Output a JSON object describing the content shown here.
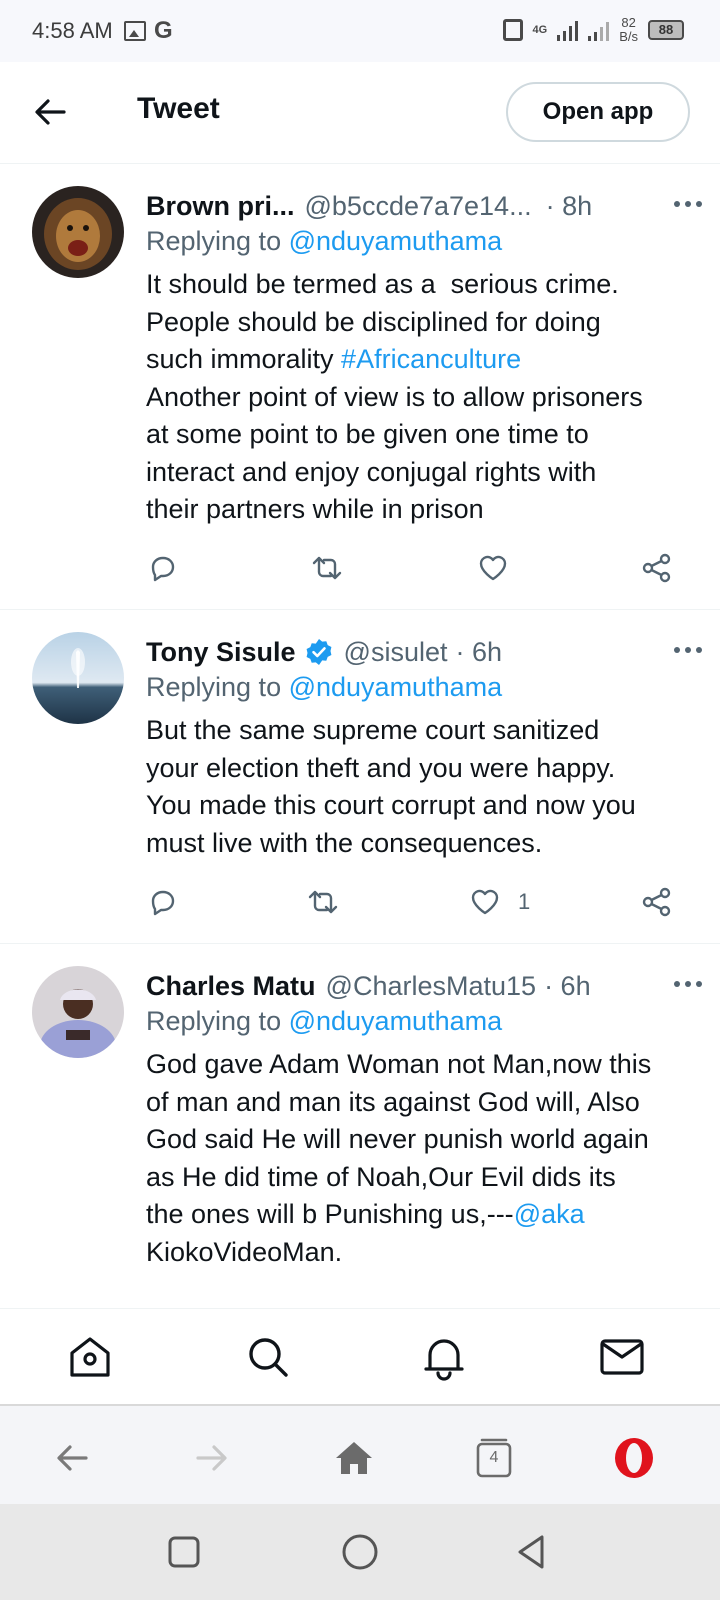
{
  "status_bar": {
    "time": "4:58 AM",
    "net_type": "4G",
    "speed_value": "82",
    "speed_unit": "B/s",
    "battery": "88"
  },
  "header": {
    "title": "Tweet",
    "open_app_label": "Open app"
  },
  "tweets": [
    {
      "name": "Brown pri...",
      "handle": "@b5ccde7a7e14...",
      "time": "· 8h",
      "replying_prefix": "Replying to ",
      "replying_to": "@nduyamuthama",
      "text_1": "It should be termed as a  serious crime.\nPeople should be disciplined for doing\nsuch immorality ",
      "hashtag": "#Africanculture",
      "text_2": "\nAnother point of view is to allow prisoners\nat some point to be given one time to\ninteract and enjoy conjugal rights with\ntheir partners while in prison",
      "likes": ""
    },
    {
      "name": "Tony Sisule",
      "verified": true,
      "handle": "@sisulet",
      "time": "· 6h",
      "replying_prefix": "Replying to ",
      "replying_to": "@nduyamuthama",
      "text_1": "But the same supreme court sanitized\nyour election theft and you were happy.\nYou made this court corrupt and now you\nmust live with the consequences.",
      "likes": "1"
    },
    {
      "name": "Charles Matu",
      "handle": "@CharlesMatu15",
      "time": "· 6h",
      "replying_prefix": "Replying to ",
      "replying_to": "@nduyamuthama",
      "text_1": "God gave Adam Woman not Man,now this\nof man and man its against God will, Also\nGod said He will never punish world again\nas He did time of Noah,Our Evil dids its\nthe ones will b Punishing us,---",
      "mention_inline": "@aka",
      "text_2": "\nKiokoVideoMan."
    }
  ],
  "browser_bar": {
    "tabs_count": "4"
  },
  "colors": {
    "accent": "#1d9bf0",
    "secondary_text": "#536471",
    "opera_red": "#e0131d"
  }
}
